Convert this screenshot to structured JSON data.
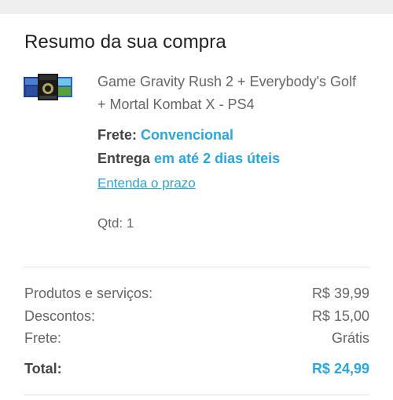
{
  "summary": {
    "title": "Resumo da sua compra",
    "product": {
      "name": "Game Gravity Rush 2 + Everybody's Golf + Mortal Kombat X  - PS4",
      "image_icon": "product-bundle-thumbnail-icon"
    },
    "shipping": {
      "label": "Frete:",
      "method": "Convencional"
    },
    "delivery": {
      "label": "Entrega",
      "time": "em até 2 dias úteis"
    },
    "deadline_link": "Entenda o prazo",
    "quantity": "Qtd: 1"
  },
  "totals": {
    "products_label": "Produtos e serviços:",
    "products_value": "R$ 39,99",
    "discounts_label": "Descontos:",
    "discounts_value": "R$ 15,00",
    "shipping_label": "Frete:",
    "shipping_value": "Grátis",
    "total_label": "Total:",
    "total_value": "R$ 24,99"
  },
  "colors": {
    "accent": "#2aa6dd",
    "background_strip": "#efefef",
    "divider": "#e2e2e2"
  }
}
